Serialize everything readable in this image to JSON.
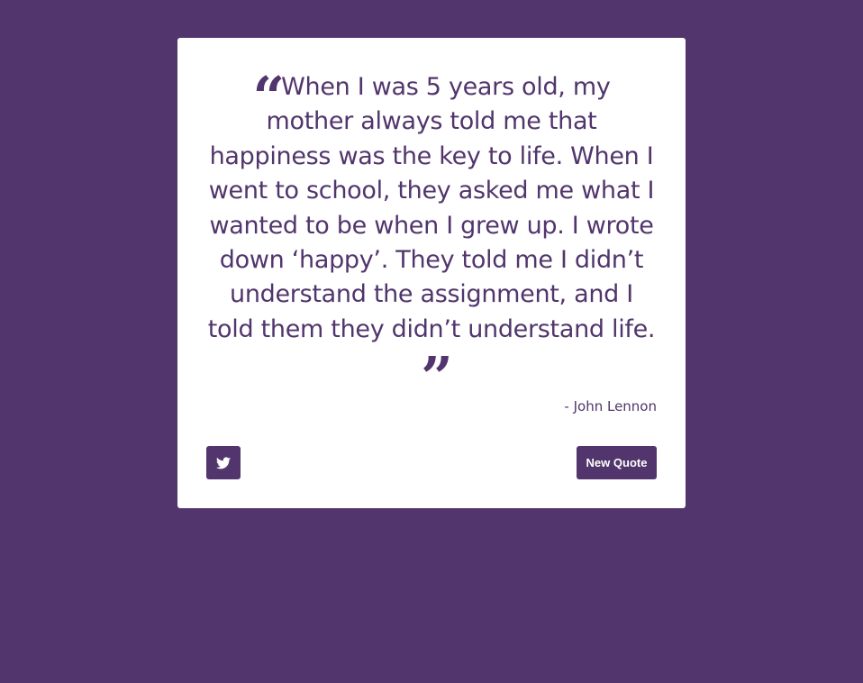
{
  "quote": {
    "text": "When I was 5 years old, my mother always told me that happiness was the key to life. When I went to school, they asked me what I wanted to be when I grew up. I wrote down ‘happy’. They told me I didn’t understand the assignment, and I told them they didn’t understand life.",
    "open_mark": "“",
    "close_mark": "”",
    "author": "- John Lennon"
  },
  "actions": {
    "tweet_icon": "twitter-icon",
    "new_quote_label": "New Quote"
  },
  "colors": {
    "background": "#51356c",
    "card": "#ffffff",
    "accent": "#51356c",
    "button_text": "#ffffff"
  }
}
